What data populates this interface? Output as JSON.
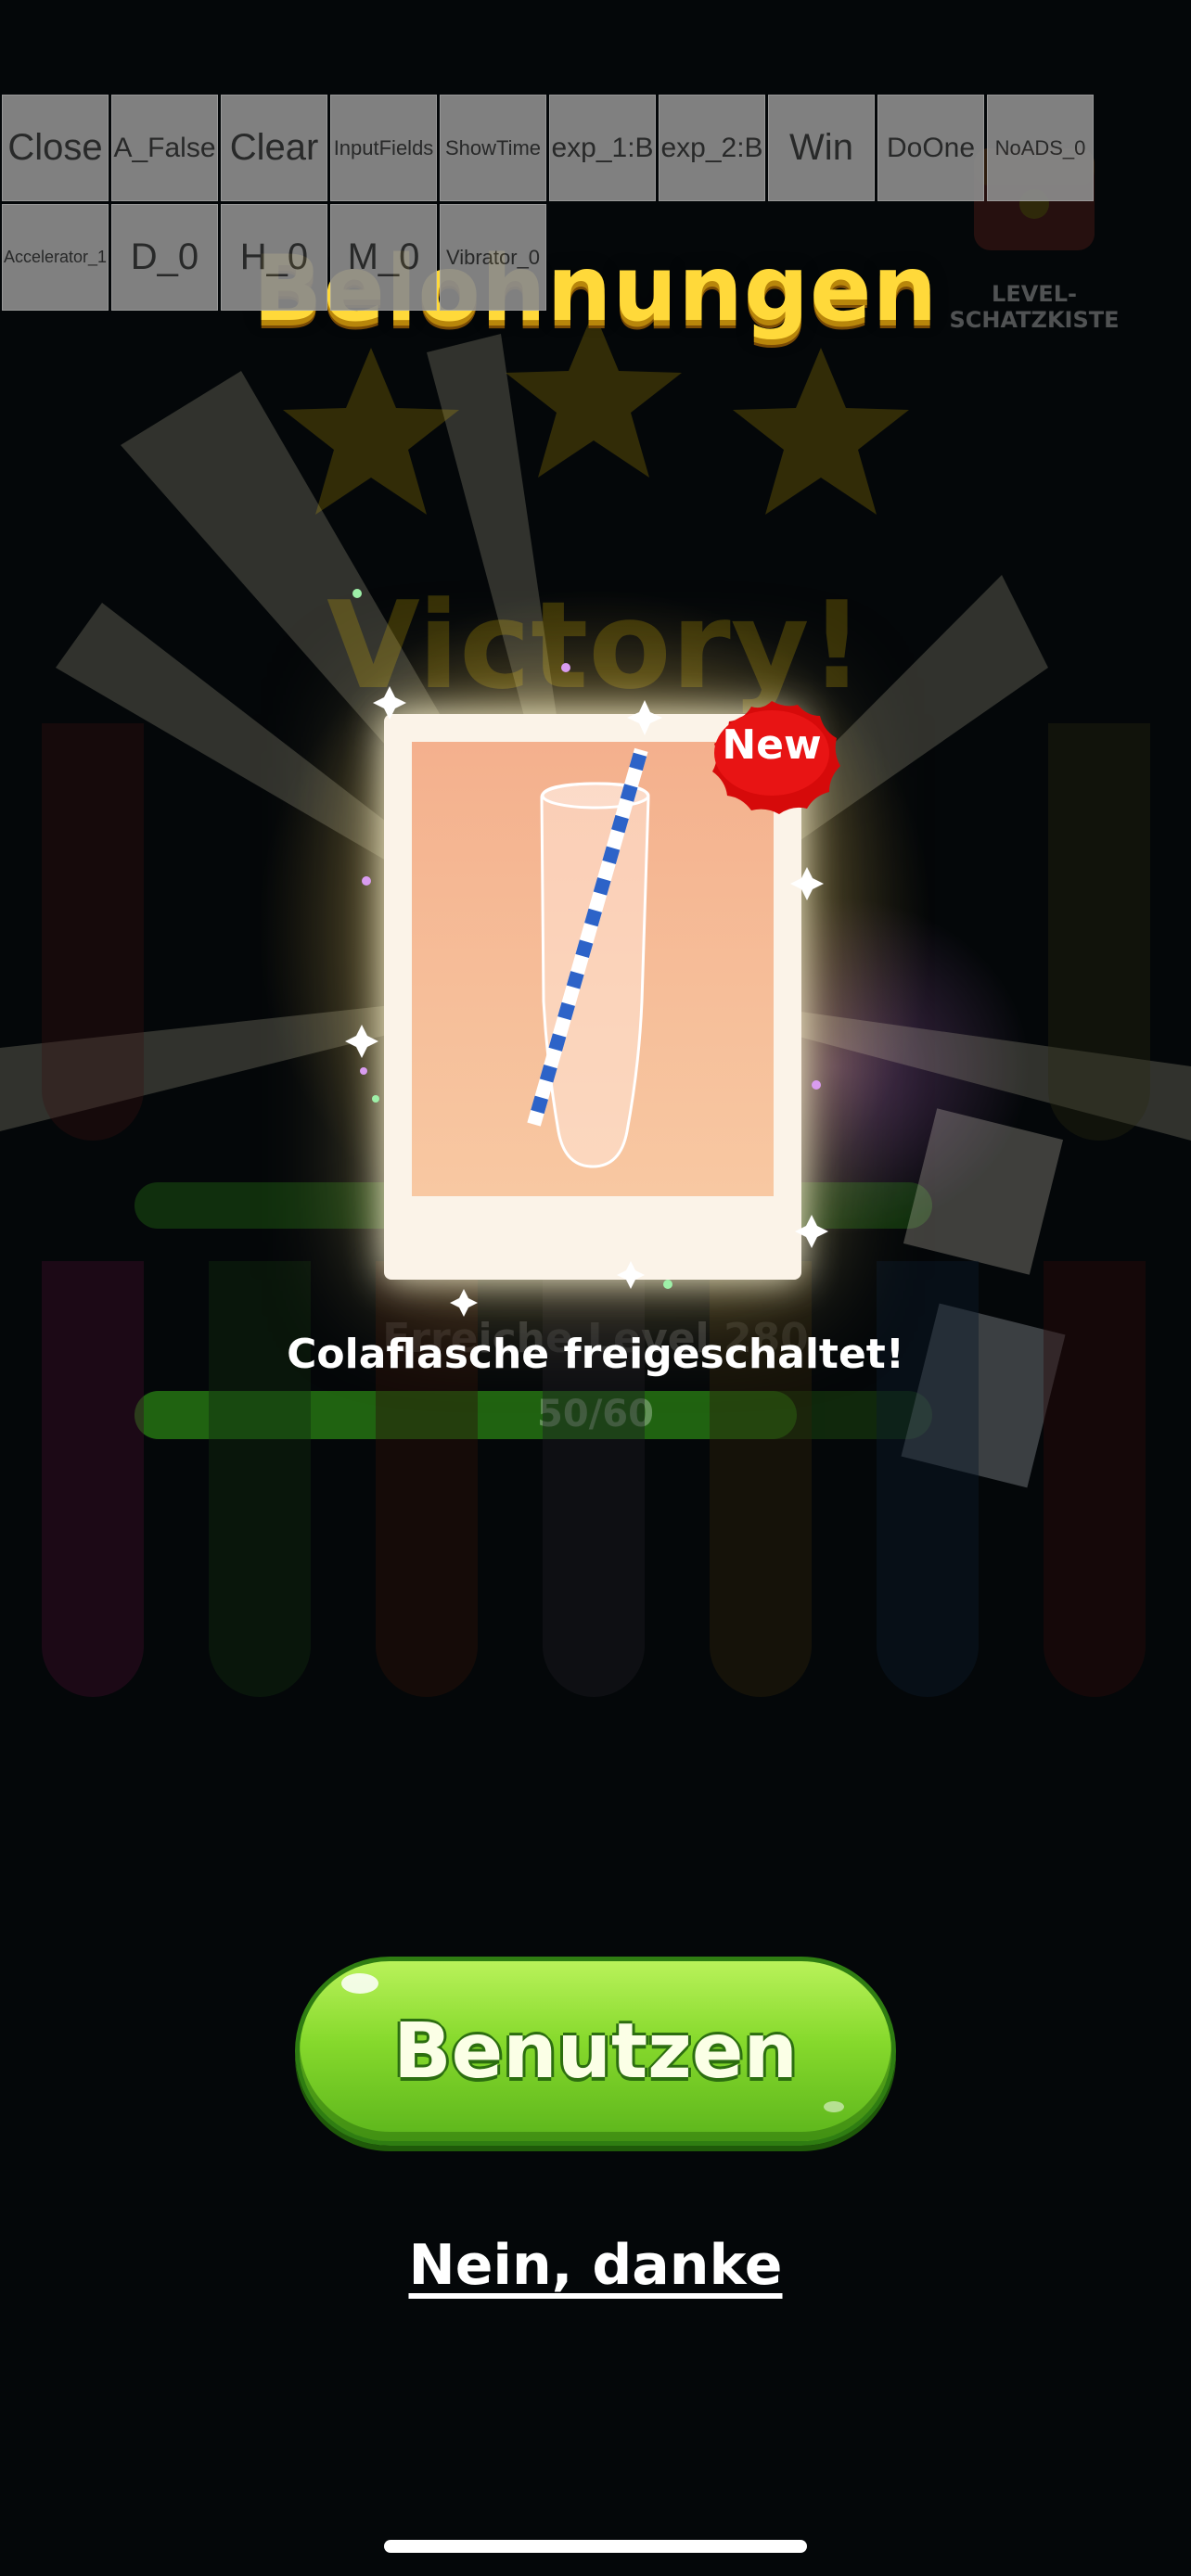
{
  "debug_buttons": [
    {
      "label": "Close",
      "size": "big"
    },
    {
      "label": "A_False",
      "size": "mid"
    },
    {
      "label": "Clear",
      "size": "big"
    },
    {
      "label": "InputFields",
      "size": "sm"
    },
    {
      "label": "ShowTime",
      "size": "sm"
    },
    {
      "label": "exp_1:B",
      "size": "mid"
    },
    {
      "label": "exp_2:B",
      "size": "mid"
    },
    {
      "label": "Win",
      "size": "big"
    },
    {
      "label": "DoOne",
      "size": "mid"
    },
    {
      "label": "NoADS_0",
      "size": "sm"
    },
    {
      "label": "Accelerator_1",
      "size": "xs"
    },
    {
      "label": "D_0",
      "size": "big"
    },
    {
      "label": "H_0",
      "size": "big"
    },
    {
      "label": "M_0",
      "size": "big"
    },
    {
      "label": "Vibrator_0",
      "size": "sm"
    }
  ],
  "background": {
    "chest_label": "LEVEL-SCHATZKISTE",
    "victory_text": "Victory!",
    "progress_label": "Erreiche Level 280",
    "progress_value": "50/60"
  },
  "dialog": {
    "title": "Belohnungen",
    "new_badge": "New",
    "unlock_message": "Colaflasche freigeschaltet!",
    "use_button": "Benutzen",
    "decline_link": "Nein, danke"
  },
  "colors": {
    "title": "#ffd93a",
    "button_green": "#86d92c",
    "badge_red": "#d60a0a"
  }
}
